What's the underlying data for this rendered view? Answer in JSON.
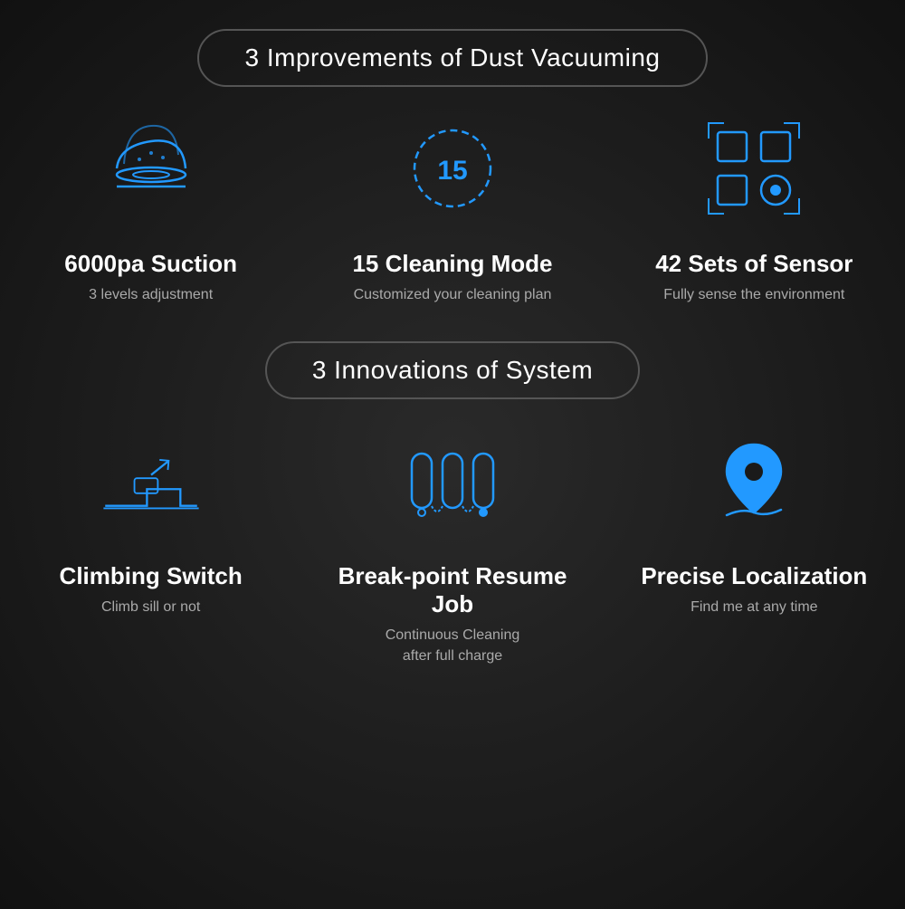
{
  "section1": {
    "badge": "3 Improvements of Dust Vacuuming",
    "features": [
      {
        "id": "suction",
        "title": "6000pa Suction",
        "subtitle": "3 levels adjustment"
      },
      {
        "id": "mode",
        "title": "15 Cleaning Mode",
        "subtitle": "Customized your cleaning plan"
      },
      {
        "id": "sensor",
        "title": "42 Sets of Sensor",
        "subtitle": "Fully sense the environment"
      }
    ]
  },
  "section2": {
    "badge": "3 Innovations of System",
    "features": [
      {
        "id": "climb",
        "title": "Climbing Switch",
        "subtitle": "Climb sill or not"
      },
      {
        "id": "resume",
        "title": "Break-point Resume Job",
        "subtitle": "Continuous Cleaning\nafter full charge"
      },
      {
        "id": "locate",
        "title": "Precise Localization",
        "subtitle": "Find me at any time"
      }
    ]
  },
  "colors": {
    "blue": "#2299ff",
    "text_primary": "#ffffff",
    "text_secondary": "#aaaaaa",
    "badge_border": "#555555",
    "bg": "#1a1a1a"
  }
}
